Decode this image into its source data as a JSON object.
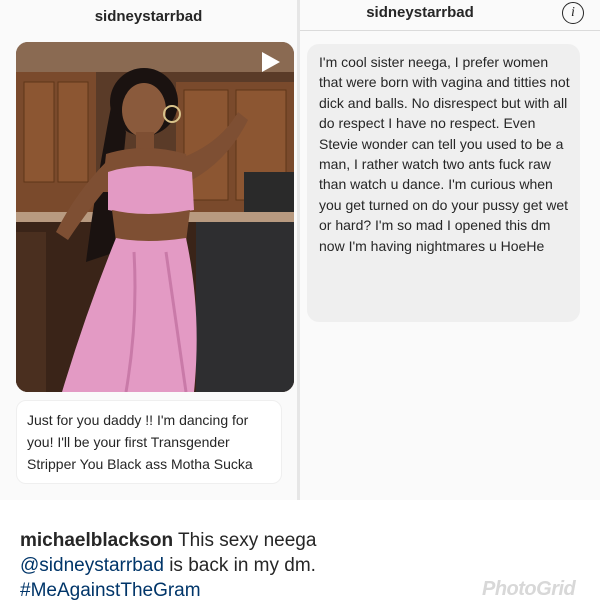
{
  "left_panel": {
    "username": "sidneystarrbad",
    "caption": "Just for you daddy !! I'm dancing for you! I'll be your first Transgender Stripper You Black ass Motha Sucka"
  },
  "right_panel": {
    "username": "sidneystarrbad",
    "info_icon_glyph": "i",
    "message": "I'm cool sister neega, I prefer women that were born with vagina and titties not dick and balls. No disrespect but with all do respect I have no respect. Even Stevie wonder can tell you used to be a man, I rather watch two ants fuck raw than watch u dance. I'm curious when you get  turned on do your pussy get wet or hard? I'm so mad I opened this dm now I'm having nightmares u HoeHe"
  },
  "post": {
    "username": "michaelblackson",
    "text": " This sexy neega",
    "mention": "@sidneystarrbad",
    "text_after_mention": " is back in my dm.",
    "hashtag": "#MeAgainstTheGram"
  },
  "watermark": "PhotoGrid",
  "colors": {
    "link": "#003569",
    "bubble_gray": "#efefef",
    "outfit_pink": "#e39ac4"
  },
  "icons": [
    "play-icon",
    "info-icon"
  ]
}
